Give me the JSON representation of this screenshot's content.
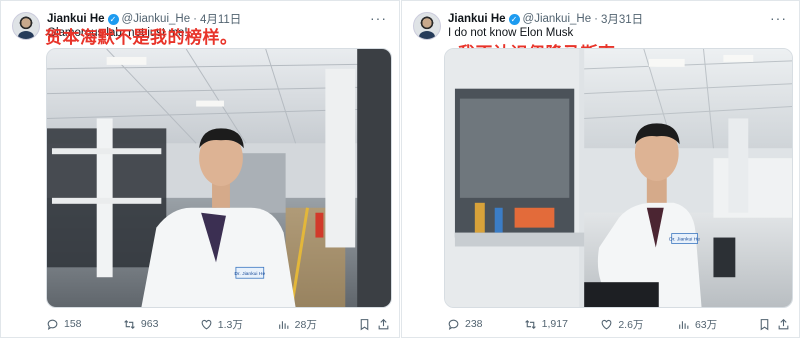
{
  "tweets": [
    {
      "author_name": "Jiankui He",
      "handle": "@Jiankui_He",
      "separator": "·",
      "date": "4月11日",
      "text": "Glamorous lab, not just me!",
      "overlay_caption": "贺本海默不是我的榜样。",
      "stats": {
        "replies": "158",
        "retweets": "963",
        "likes": "1.3万",
        "views": "28万"
      }
    },
    {
      "author_name": "Jiankui He",
      "handle": "@Jiankui_He",
      "separator": "·",
      "date": "3月31日",
      "text": "I do not know Elon Musk",
      "overlay_caption": "我不认识伊隆马斯克",
      "stats": {
        "replies": "238",
        "retweets": "1,917",
        "likes": "2.6万",
        "views": "63万"
      }
    }
  ],
  "more_label": "···",
  "badge_label": "Dr. Jiankui He",
  "icons": [
    "verified-badge-icon",
    "more-icon",
    "reply-icon",
    "retweet-icon",
    "like-icon",
    "views-icon",
    "bookmark-icon",
    "share-icon"
  ],
  "colors": {
    "verified": "#1d9bf0",
    "caption": "#e8342a",
    "muted": "#536471"
  }
}
